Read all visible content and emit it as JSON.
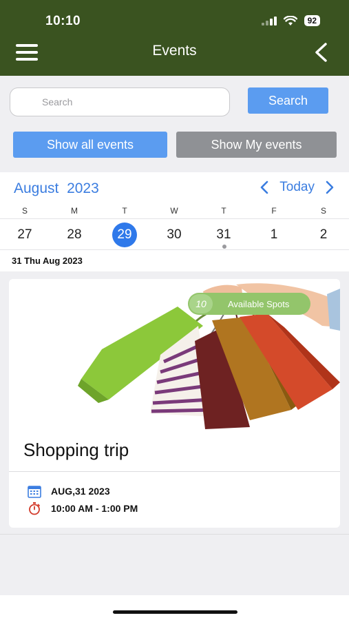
{
  "status_bar": {
    "time": "10:10",
    "battery": "92"
  },
  "nav": {
    "title": "Events"
  },
  "search": {
    "placeholder": "Search",
    "value": "",
    "button_label": "Search"
  },
  "filters": {
    "all_label": "Show all events",
    "mine_label": "Show My events"
  },
  "calendar": {
    "month": "August",
    "year": "2023",
    "today_label": "Today",
    "weekdays": [
      "S",
      "M",
      "T",
      "W",
      "T",
      "F",
      "S"
    ],
    "dates": [
      "27",
      "28",
      "29",
      "30",
      "31",
      "1",
      "2"
    ],
    "selected_date": "29",
    "event_marker_date": "31"
  },
  "day_header": "31 Thu Aug 2023",
  "event": {
    "title": "Shopping trip",
    "spots_count": "10",
    "spots_label": "Available Spots",
    "date": "AUG,31 2023",
    "time": "10:00 AM - 1:00 PM"
  },
  "colors": {
    "header_bg": "#3a5320",
    "primary_blue": "#5b9cf0",
    "calendar_accent": "#3b7de0",
    "secondary_gray": "#8f9195",
    "spots_green": "#93c56b"
  }
}
